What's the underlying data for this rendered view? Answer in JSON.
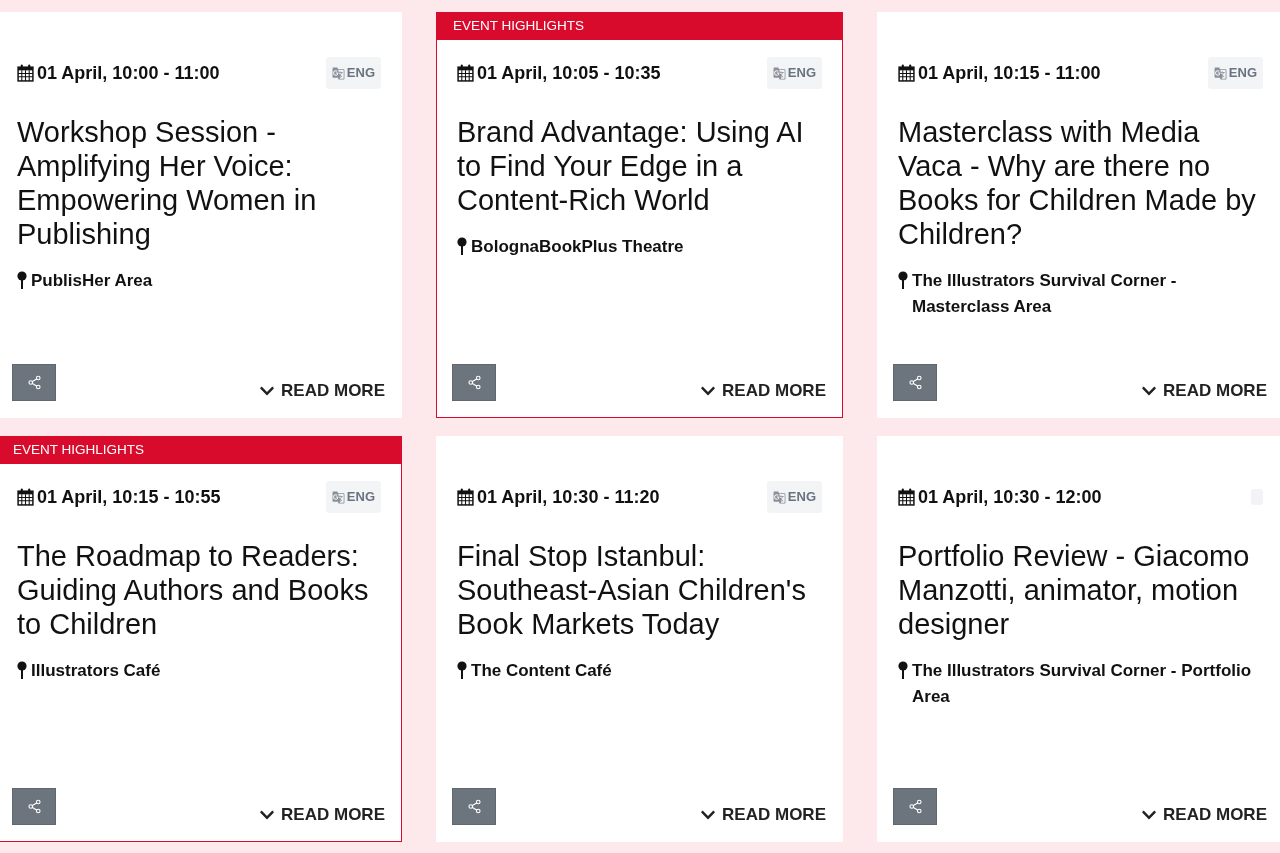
{
  "events": [
    {
      "highlighted": false,
      "date": "01 April, 10:00 - 11:00",
      "language": {
        "kind": "labeled",
        "label": "ENG"
      },
      "title": "Workshop Session - Amplifying Her Voice: Empowering Women in Publishing",
      "location": "PublisHer Area",
      "action": "READ MORE"
    },
    {
      "highlighted": true,
      "banner": "EVENT HIGHLIGHTS",
      "date": "01 April, 10:05 - 10:35",
      "language": {
        "kind": "labeled",
        "label": "ENG"
      },
      "title": "Brand Advantage: Using AI to Find Your Edge in a Content-Rich World",
      "location": "BolognaBookPlus Theatre",
      "action": "READ MORE"
    },
    {
      "highlighted": false,
      "date": "01 April, 10:15 - 11:00",
      "language": {
        "kind": "labeled",
        "label": "ENG"
      },
      "title": "Masterclass with Media Vaca - Why are there no Books for Children Made by Children?",
      "location": "The Illustrators Survival Corner - Masterclass Area",
      "action": "READ MORE"
    },
    {
      "highlighted": true,
      "banner": "EVENT HIGHLIGHTS",
      "date": "01 April, 10:15 - 10:55",
      "language": {
        "kind": "labeled",
        "label": "ENG"
      },
      "title": "The Roadmap to Readers: Guiding Authors and Books to Children",
      "location": "Illustrators Café",
      "action": "READ MORE"
    },
    {
      "highlighted": false,
      "date": "01 April, 10:30 - 11:20",
      "language": {
        "kind": "labeled",
        "label": "ENG"
      },
      "title": "Final Stop Istanbul: Southeast-Asian Children's Book Markets Today",
      "location": "The Content Café",
      "action": "READ MORE"
    },
    {
      "highlighted": false,
      "date": "01 April, 10:30 - 12:00",
      "language": {
        "kind": "blank"
      },
      "title": "Portfolio Review - Giacomo Manzotti, animator, motion designer",
      "location": "The Illustrators Survival Corner - Portfolio Area",
      "action": "READ MORE"
    }
  ]
}
